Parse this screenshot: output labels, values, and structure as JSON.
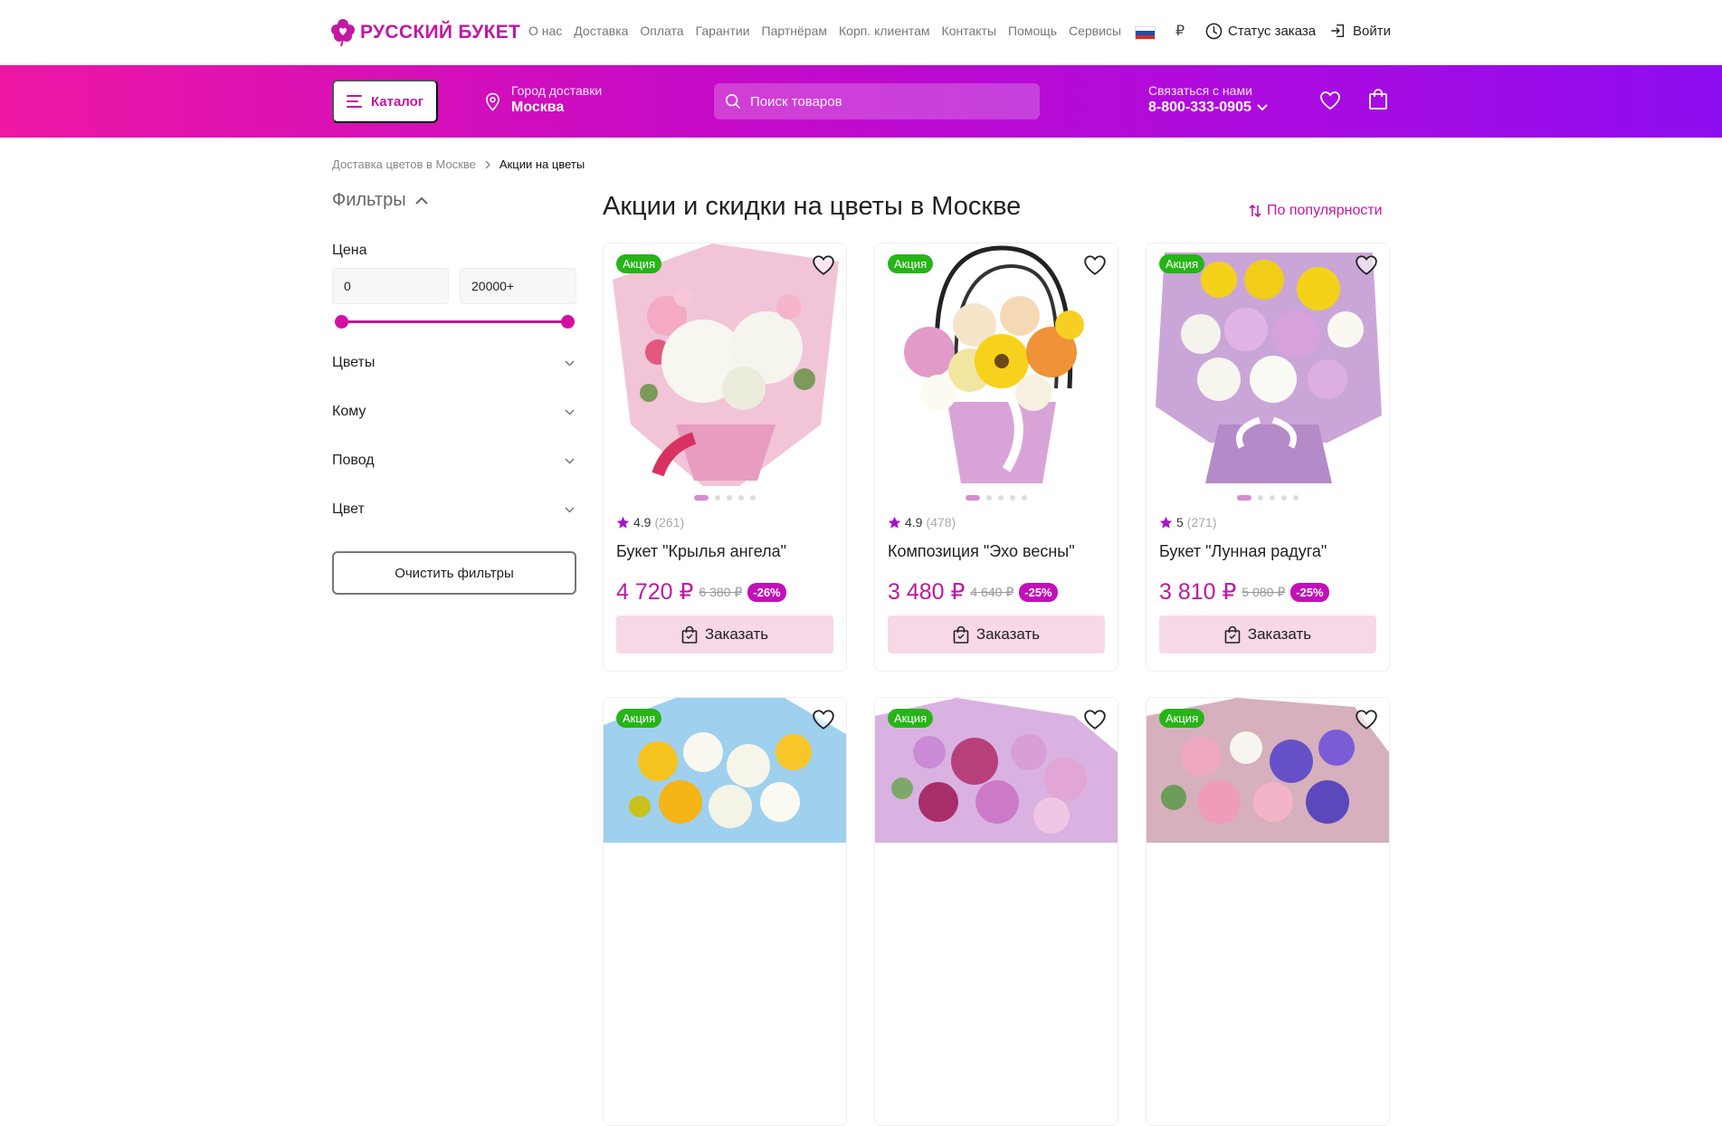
{
  "brand": {
    "name": "РУССКИЙ БУКЕТ"
  },
  "topnav": [
    "О нас",
    "Доставка",
    "Оплата",
    "Гарантии",
    "Партнёрам",
    "Корп. клиентам",
    "Контакты",
    "Помощь",
    "Сервисы"
  ],
  "header": {
    "currency": "₽",
    "order_status": "Статус заказа",
    "login": "Войти",
    "catalog": "Каталог",
    "city_label": "Город доставки",
    "city_value": "Москва",
    "search_placeholder": "Поиск товаров",
    "contact_label": "Связаться с нами",
    "phone": "8-800-333-0905"
  },
  "breadcrumb": {
    "home": "Доставка цветов в Москве",
    "current": "Акции на цветы"
  },
  "filters": {
    "title": "Фильтры",
    "price_label": "Цена",
    "price_min": "0",
    "price_max": "20000+",
    "sections": [
      "Цветы",
      "Кому",
      "Повод",
      "Цвет"
    ],
    "clear": "Очистить фильтры"
  },
  "page": {
    "title": "Акции и скидки на цветы в Москве",
    "sort": "По популярности"
  },
  "products": [
    {
      "badge": "Акция",
      "rating": "4.9",
      "reviews": "(261)",
      "name": "Букет \"Крылья ангела\"",
      "price": "4 720 ₽",
      "old_price": "6 380 ₽",
      "discount": "-26%",
      "cta": "Заказать"
    },
    {
      "badge": "Акция",
      "rating": "4.9",
      "reviews": "(478)",
      "name": "Композиция \"Эхо весны\"",
      "price": "3 480 ₽",
      "old_price": "4 640 ₽",
      "discount": "-25%",
      "cta": "Заказать"
    },
    {
      "badge": "Акция",
      "rating": "5",
      "reviews": "(271)",
      "name": "Букет \"Лунная радуга\"",
      "price": "3 810 ₽",
      "old_price": "5 080 ₽",
      "discount": "-25%",
      "cta": "Заказать"
    },
    {
      "badge": "Акция"
    },
    {
      "badge": "Акция"
    },
    {
      "badge": "Акция"
    }
  ],
  "colors": {
    "accent": "#c0179e",
    "badge": "#27b418",
    "order_bg": "#f7d8e7",
    "discount": "#c210b8"
  }
}
